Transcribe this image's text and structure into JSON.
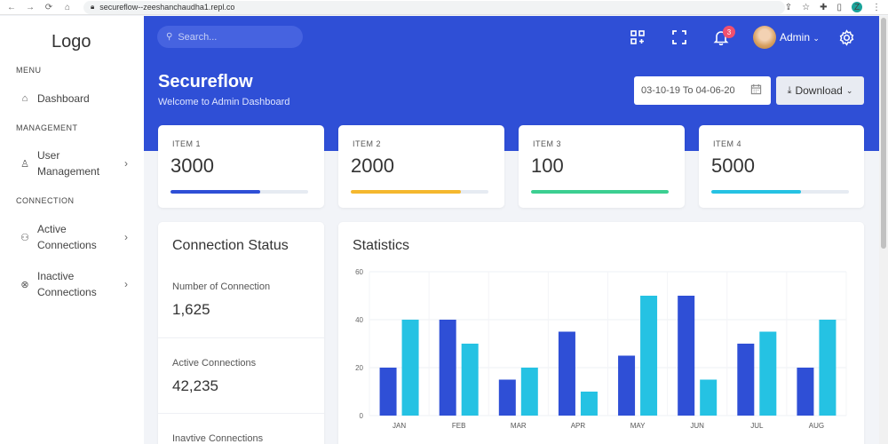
{
  "browser": {
    "url": "secureflow--zeeshanchaudha1.repl.co",
    "profile_initial": "Z"
  },
  "sidebar": {
    "logo": "Logo",
    "sections": {
      "menu": "MENU",
      "management": "MANAGEMENT",
      "connection": "CONNECTION"
    },
    "items": [
      {
        "label": "Dashboard",
        "icon": "home-icon"
      },
      {
        "label": "User Management",
        "icon": "user-icon"
      },
      {
        "label": "Active Connections",
        "icon": "connections-icon"
      },
      {
        "label": "Inactive Connections",
        "icon": "cancel-circle-icon"
      }
    ]
  },
  "header": {
    "search_placeholder": "Search...",
    "notification_count": "3",
    "user_name": "Admin"
  },
  "page": {
    "title": "Secureflow",
    "subtitle": "Welcome to Admin Dashboard",
    "date_range": "03-10-19 To 04-06-20",
    "download_label": "Download"
  },
  "kpis": [
    {
      "label": "ITEM 1",
      "value": "3000",
      "progress": 0.65,
      "color": "#2f4fd6"
    },
    {
      "label": "ITEM 2",
      "value": "2000",
      "progress": 0.8,
      "color": "#f5b82e"
    },
    {
      "label": "ITEM 3",
      "value": "100",
      "progress": 1.0,
      "color": "#3ccf91"
    },
    {
      "label": "ITEM 4",
      "value": "5000",
      "progress": 0.65,
      "color": "#25c2e3"
    }
  ],
  "connection_status": {
    "title": "Connection Status",
    "rows": [
      {
        "label": "Number of Connection",
        "value": "1,625"
      },
      {
        "label": "Active Connections",
        "value": "42,235"
      },
      {
        "label": "Inavtive Connections",
        "value": ""
      }
    ]
  },
  "statistics": {
    "title": "Statistics"
  },
  "chart_data": {
    "type": "bar",
    "categories": [
      "JAN",
      "FEB",
      "MAR",
      "APR",
      "MAY",
      "JUN",
      "JUL",
      "AUG"
    ],
    "series": [
      {
        "values": [
          20,
          40,
          15,
          35,
          25,
          50,
          30,
          20
        ],
        "color": "#2f4fd6"
      },
      {
        "values": [
          40,
          30,
          20,
          10,
          50,
          15,
          35,
          40
        ],
        "color": "#25c2e3"
      }
    ],
    "yticks": [
      0,
      20,
      40,
      60
    ],
    "ylim": [
      0,
      60
    ],
    "grid": true
  }
}
